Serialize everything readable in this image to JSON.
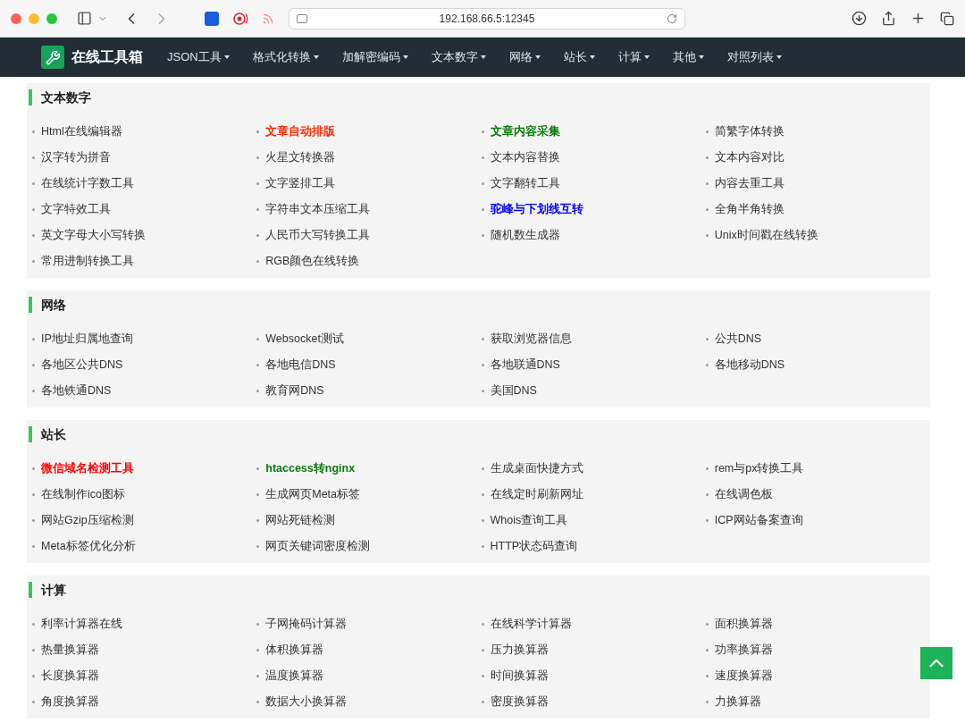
{
  "browser": {
    "address": "192.168.66.5:12345"
  },
  "navbar": {
    "brand": "在线工具箱",
    "menus": [
      {
        "label": "JSON工具"
      },
      {
        "label": "格式化转换"
      },
      {
        "label": "加解密编码"
      },
      {
        "label": "文本数字"
      },
      {
        "label": "网络"
      },
      {
        "label": "站长"
      },
      {
        "label": "计算"
      },
      {
        "label": "其他"
      },
      {
        "label": "对照列表"
      }
    ]
  },
  "sections": [
    {
      "title": "文本数字",
      "items": [
        {
          "label": "Html在线编辑器"
        },
        {
          "label": "文章自动排版",
          "color": "#ff2a00"
        },
        {
          "label": "文章内容采集",
          "color": "#0a7a0a"
        },
        {
          "label": "简繁字体转换"
        },
        {
          "label": "汉字转为拼音"
        },
        {
          "label": "火星文转换器"
        },
        {
          "label": "文本内容替换"
        },
        {
          "label": "文本内容对比"
        },
        {
          "label": "在线统计字数工具"
        },
        {
          "label": "文字竖排工具"
        },
        {
          "label": "文字翻转工具"
        },
        {
          "label": "内容去重工具"
        },
        {
          "label": "文字特效工具"
        },
        {
          "label": "字符串文本压缩工具"
        },
        {
          "label": "驼峰与下划线互转",
          "color": "#0000ff"
        },
        {
          "label": "全角半角转换"
        },
        {
          "label": "英文字母大小写转换"
        },
        {
          "label": "人民币大写转换工具"
        },
        {
          "label": "随机数生成器"
        },
        {
          "label": "Unix时间戳在线转换"
        },
        {
          "label": "常用进制转换工具"
        },
        {
          "label": "RGB颜色在线转换"
        }
      ]
    },
    {
      "title": "网络",
      "items": [
        {
          "label": "IP地址归属地查询"
        },
        {
          "label": "Websocket测试"
        },
        {
          "label": "获取浏览器信息"
        },
        {
          "label": "公共DNS"
        },
        {
          "label": "各地区公共DNS"
        },
        {
          "label": "各地电信DNS"
        },
        {
          "label": "各地联通DNS"
        },
        {
          "label": "各地移动DNS"
        },
        {
          "label": "各地铁通DNS"
        },
        {
          "label": "教育网DNS"
        },
        {
          "label": "美国DNS"
        }
      ]
    },
    {
      "title": "站长",
      "items": [
        {
          "label": "微信域名检测工具",
          "color": "#ff0000"
        },
        {
          "label": "htaccess转nginx",
          "color": "#0a7a0a"
        },
        {
          "label": "生成桌面快捷方式"
        },
        {
          "label": "rem与px转换工具"
        },
        {
          "label": "在线制作ico图标"
        },
        {
          "label": "生成网页Meta标签"
        },
        {
          "label": "在线定时刷新网址"
        },
        {
          "label": "在线调色板"
        },
        {
          "label": "网站Gzip压缩检测"
        },
        {
          "label": "网站死链检测"
        },
        {
          "label": "Whois查询工具"
        },
        {
          "label": "ICP网站备案查询"
        },
        {
          "label": "Meta标签优化分析"
        },
        {
          "label": "网页关键词密度检测"
        },
        {
          "label": "HTTP状态码查询"
        }
      ]
    },
    {
      "title": "计算",
      "items": [
        {
          "label": "利率计算器在线"
        },
        {
          "label": "子网掩码计算器"
        },
        {
          "label": "在线科学计算器"
        },
        {
          "label": "面积换算器"
        },
        {
          "label": "热量换算器"
        },
        {
          "label": "体积换算器"
        },
        {
          "label": "压力换算器"
        },
        {
          "label": "功率换算器"
        },
        {
          "label": "长度换算器"
        },
        {
          "label": "温度换算器"
        },
        {
          "label": "时间换算器"
        },
        {
          "label": "速度换算器"
        },
        {
          "label": "角度换算器"
        },
        {
          "label": "数据大小换算器"
        },
        {
          "label": "密度换算器"
        },
        {
          "label": "力换算器"
        }
      ]
    }
  ]
}
